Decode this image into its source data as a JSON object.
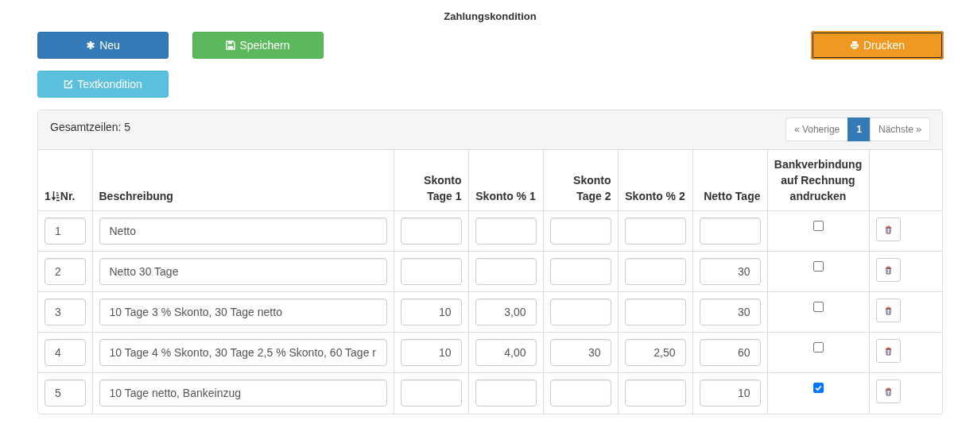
{
  "title": "Zahlungskondition",
  "buttons": [
    {
      "label": "Neu",
      "kind": "new"
    },
    {
      "label": "Speichern",
      "kind": "save"
    },
    {
      "label": "Drucken",
      "kind": "print"
    },
    {
      "label": "Textkondition",
      "kind": "text"
    }
  ],
  "panel": {
    "total": "Gesamtzeilen: 5",
    "pagination": [
      {
        "label": "« Voherige",
        "selected": false
      },
      {
        "label": "1",
        "selected": true
      },
      {
        "label": "Nächste »",
        "selected": false
      }
    ]
  },
  "table": {
    "sort_glyph": "1",
    "columns": [
      "Nr.",
      "Beschreibung",
      "Skonto Tage 1",
      "Skonto % 1",
      "Skonto Tage 2",
      "Skonto % 2",
      "Netto Tage",
      "Bankverbindung auf Rechnung andrucken"
    ],
    "rows": [
      {
        "nr": "1",
        "description": "Netto",
        "bank_print": false
      },
      {
        "nr": "2",
        "description": "Netto 30 Tage",
        "net_days": "30",
        "bank_print": false
      },
      {
        "nr": "3",
        "description": "10 Tage 3 % Skonto, 30 Tage netto",
        "skonto_days_1": "10",
        "skonto_pct_1": "3,00",
        "net_days": "30",
        "bank_print": false
      },
      {
        "nr": "4",
        "description": "10 Tage 4 % Skonto, 30 Tage 2,5 % Skonto, 60 Tage r",
        "skonto_days_1": "10",
        "skonto_pct_1": "4,00",
        "skonto_days_2": "30",
        "skonto_pct_2": "2,50",
        "net_days": "60",
        "bank_print": false
      },
      {
        "nr": "5",
        "description": "10 Tage netto, Bankeinzug",
        "net_days": "10",
        "bank_print": true
      }
    ]
  }
}
